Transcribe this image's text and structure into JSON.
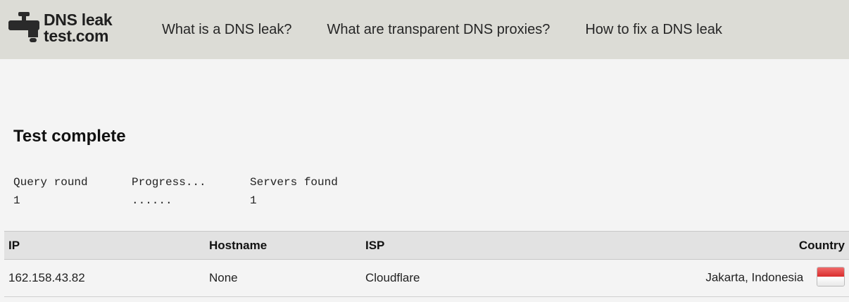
{
  "header": {
    "logo": {
      "line1": "DNS leak",
      "line2": "test.com"
    },
    "nav": [
      {
        "label": "What is a DNS leak?"
      },
      {
        "label": "What are transparent DNS proxies?"
      },
      {
        "label": "How to fix a DNS leak"
      }
    ]
  },
  "main": {
    "title": "Test complete",
    "stats": {
      "query_round": {
        "label": "Query round",
        "value": "1"
      },
      "progress": {
        "label": "Progress...",
        "value": "......"
      },
      "servers_found": {
        "label": "Servers found",
        "value": "1"
      }
    },
    "results_table": {
      "headers": [
        "IP",
        "Hostname",
        "ISP",
        "Country"
      ],
      "rows": [
        {
          "ip": "162.158.43.82",
          "hostname": "None",
          "isp": "Cloudflare",
          "country": "Jakarta, Indonesia",
          "flag_icon": "indonesia-flag-icon"
        }
      ]
    }
  },
  "colors": {
    "header_bg": "#dcdcd6",
    "page_bg": "#f4f4f4",
    "table_header_bg": "#e2e2e2",
    "flag_red": "#d92d2d"
  }
}
